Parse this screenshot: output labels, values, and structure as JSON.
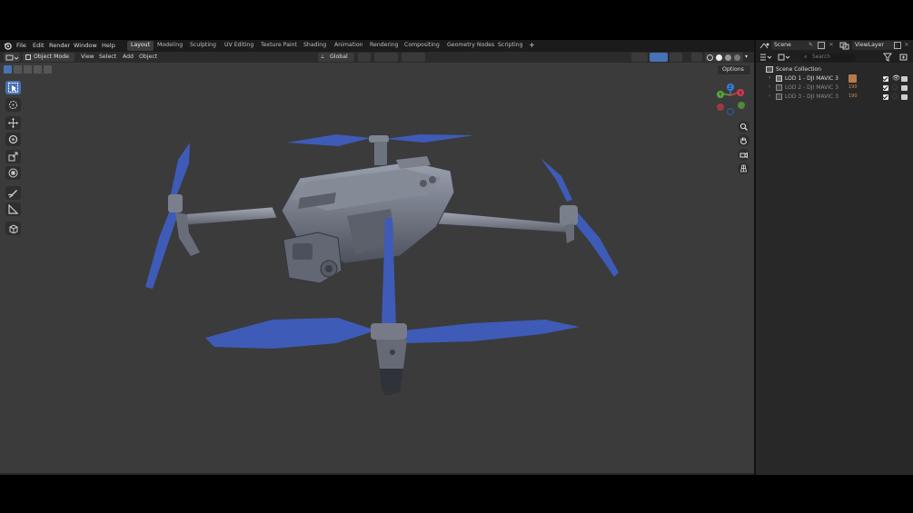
{
  "app": {
    "menu": [
      "File",
      "Edit",
      "Render",
      "Window",
      "Help"
    ],
    "workspaces": [
      "Layout",
      "Modeling",
      "Sculpting",
      "UV Editing",
      "Texture Paint",
      "Shading",
      "Animation",
      "Rendering",
      "Compositing",
      "Geometry Nodes",
      "Scripting"
    ],
    "active_workspace": "Layout",
    "add_workspace": "+"
  },
  "scene": {
    "label": "Scene",
    "view_layer": "ViewLayer"
  },
  "viewport_header": {
    "mode": "Object Mode",
    "menus": [
      "View",
      "Select",
      "Add",
      "Object"
    ],
    "transform_orientation": "Global",
    "options": "Options"
  },
  "gizmo": {
    "z": "Z",
    "y": "Y",
    "x": "X"
  },
  "outliner": {
    "search_placeholder": "Search",
    "collection": "Scene Collection",
    "items": [
      {
        "label": "LOD 1 - DJI MAVIC 3",
        "badge": "",
        "enabled": true
      },
      {
        "label": "LOD 2 - DJI MAVIC 3",
        "badge": "190",
        "enabled": false
      },
      {
        "label": "LOD 3 - DJI MAVIC 3",
        "badge": "190",
        "enabled": false
      }
    ]
  },
  "colors": {
    "viewport_bg": "#3b3b3b",
    "propeller_blue": "#3f5bb8",
    "drone_body": "#6d7280",
    "accent_active": "#4772b3"
  }
}
